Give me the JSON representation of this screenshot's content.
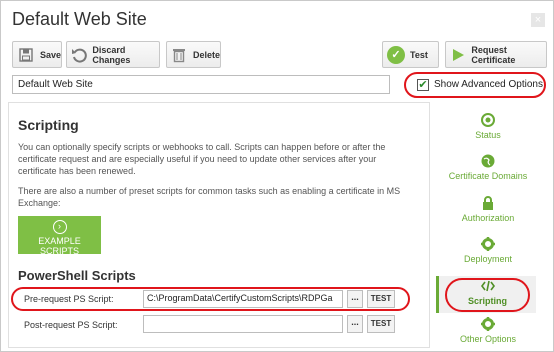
{
  "window": {
    "title": "Default Web Site",
    "close_glyph": "×"
  },
  "toolbar": {
    "save_label": "Save",
    "discard_label": "Discard Changes",
    "delete_label": "Delete",
    "test_label": "Test",
    "request_label": "Request Certificate"
  },
  "site": {
    "name_value": "Default Web Site"
  },
  "advanced": {
    "label": "Show Advanced Options",
    "checked": true
  },
  "scripting": {
    "heading": "Scripting",
    "para1_l1": "You can optionally specify scripts or webhooks to call. Scripts can happen before or after the",
    "para1_l2": "certificate request and are especially useful if you need to update other services after your",
    "para1_l3": "certificate has been renewed.",
    "para2_l1": "There are also a number of preset scripts for common tasks such as enabling a certificate in MS",
    "para2_l2": "Exchange:",
    "example_button": "EXAMPLE SCRIPTS"
  },
  "powershell": {
    "heading": "PowerShell Scripts",
    "pre_label": "Pre-request PS Script:",
    "pre_value": "C:\\ProgramData\\CertifyCustomScripts\\RDPGa",
    "post_label": "Post-request PS Script:",
    "post_value": "",
    "browse_label": "...",
    "test_label": "TEST"
  },
  "sidebar": {
    "items": [
      {
        "label": "Status",
        "icon": "target-icon"
      },
      {
        "label": "Certificate Domains",
        "icon": "globe-icon"
      },
      {
        "label": "Authorization",
        "icon": "lock-icon"
      },
      {
        "label": "Deployment",
        "icon": "gear-icon"
      },
      {
        "label": "Scripting",
        "icon": "code-icon",
        "active": true
      },
      {
        "label": "Other Options",
        "icon": "gear-icon"
      }
    ]
  },
  "colors": {
    "accent_green": "#7fbf45",
    "highlight_red": "#e0151b"
  }
}
